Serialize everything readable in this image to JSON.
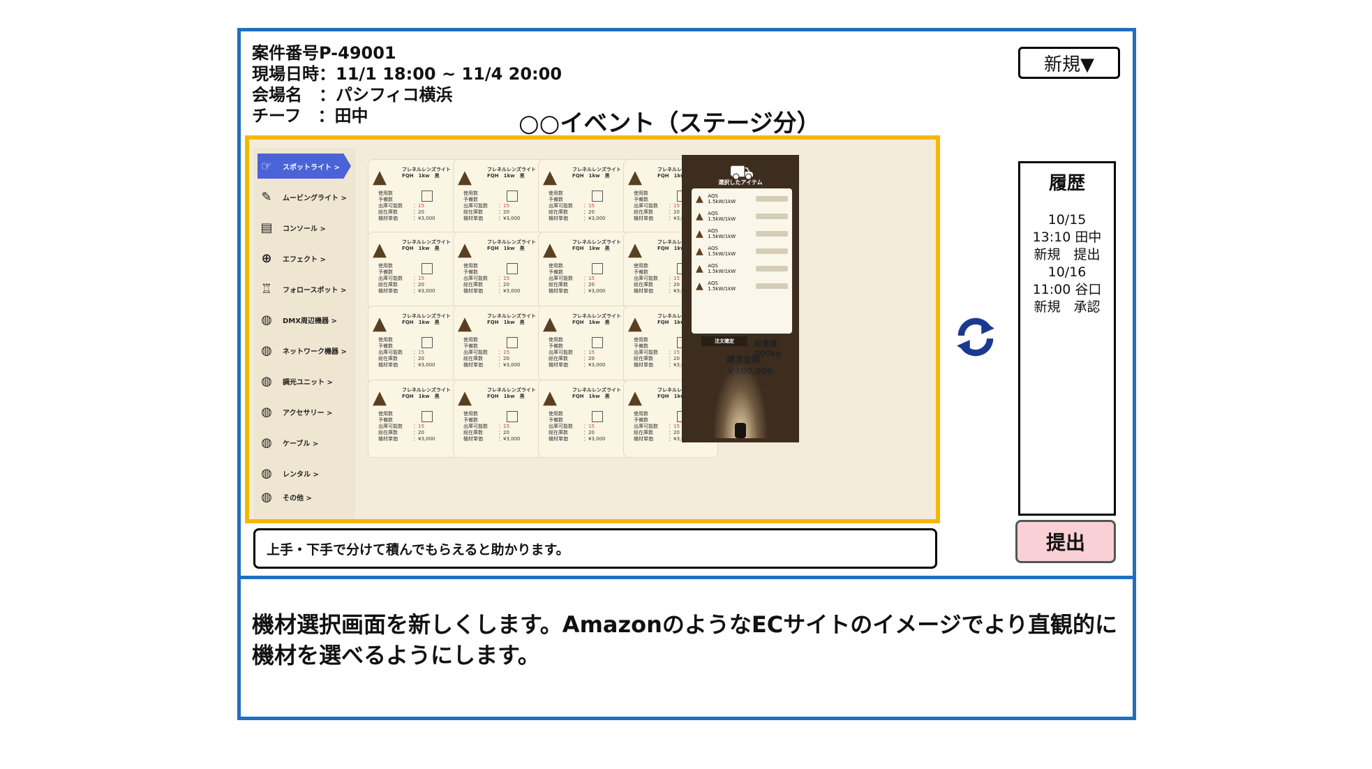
{
  "header": {
    "case_number": "案件番号P-49001",
    "site_datetime": "現場日時：11/1 18:00 ~ 11/4 20:00",
    "venue": "会場名　：パシフィコ横浜",
    "chief": "チーフ　：田中",
    "event_title": "○○イベント（ステージ分）"
  },
  "new_button": "新規▼",
  "history": {
    "title": "履歴",
    "lines": [
      "10/15",
      "13:10 田中",
      "新規　提出",
      "10/16",
      "11:00 谷口",
      "新規　承認"
    ]
  },
  "submit_button": "提出",
  "sidebar": {
    "items": [
      {
        "label": "スポットライト >",
        "icon": "spotlight-icon",
        "active": true
      },
      {
        "label": "ムービングライト >",
        "icon": "moving-light-icon"
      },
      {
        "label": "コンソール >",
        "icon": "console-icon"
      },
      {
        "label": "エフェクト >",
        "icon": "effect-icon"
      },
      {
        "label": "フォロースポット >",
        "icon": "follow-spot-icon"
      },
      {
        "label": "DMX周辺機器 >",
        "icon": "dmx-icon"
      },
      {
        "label": "ネットワーク機器 >",
        "icon": "network-icon"
      },
      {
        "label": "調光ユニット >",
        "icon": "dimmer-icon"
      },
      {
        "label": "アクセサリー >",
        "icon": "accessory-icon"
      },
      {
        "label": "ケーブル >",
        "icon": "cable-icon"
      },
      {
        "label": "レンタル >",
        "icon": "rental-icon"
      },
      {
        "label": "その他 >",
        "icon": "other-icon"
      }
    ]
  },
  "product_card": {
    "name_line1": "フレネルレンズライト",
    "name_line2": "FQH　1kw　黒",
    "spec_labels": [
      "使用数",
      "予備数",
      "出庫可能数",
      "総在庫数",
      "機材単価"
    ],
    "spec_values": [
      "",
      "",
      "：15",
      "：20",
      "：¥3,000"
    ],
    "count": 16
  },
  "cart": {
    "title": "選択したアイテム",
    "item_label": "AQS 1.5kW/1kW",
    "rows": 6,
    "order_button": "注文確定",
    "weight": "総重量 000kg",
    "total": "請求金額：￥100,000"
  },
  "memo": "上手・下手で分けて積んでもらえると助かります。",
  "description": "機材選択画面を新しくします。AmazonのようなECサイトのイメージでより直観的に機材を選べるようにします。",
  "colors": {
    "frame": "#1f6fbf",
    "highlight_border": "#f5b800",
    "active_tab": "#4a63d8",
    "submit_bg": "#f8d0d6",
    "price_red": "#e23a2e"
  }
}
